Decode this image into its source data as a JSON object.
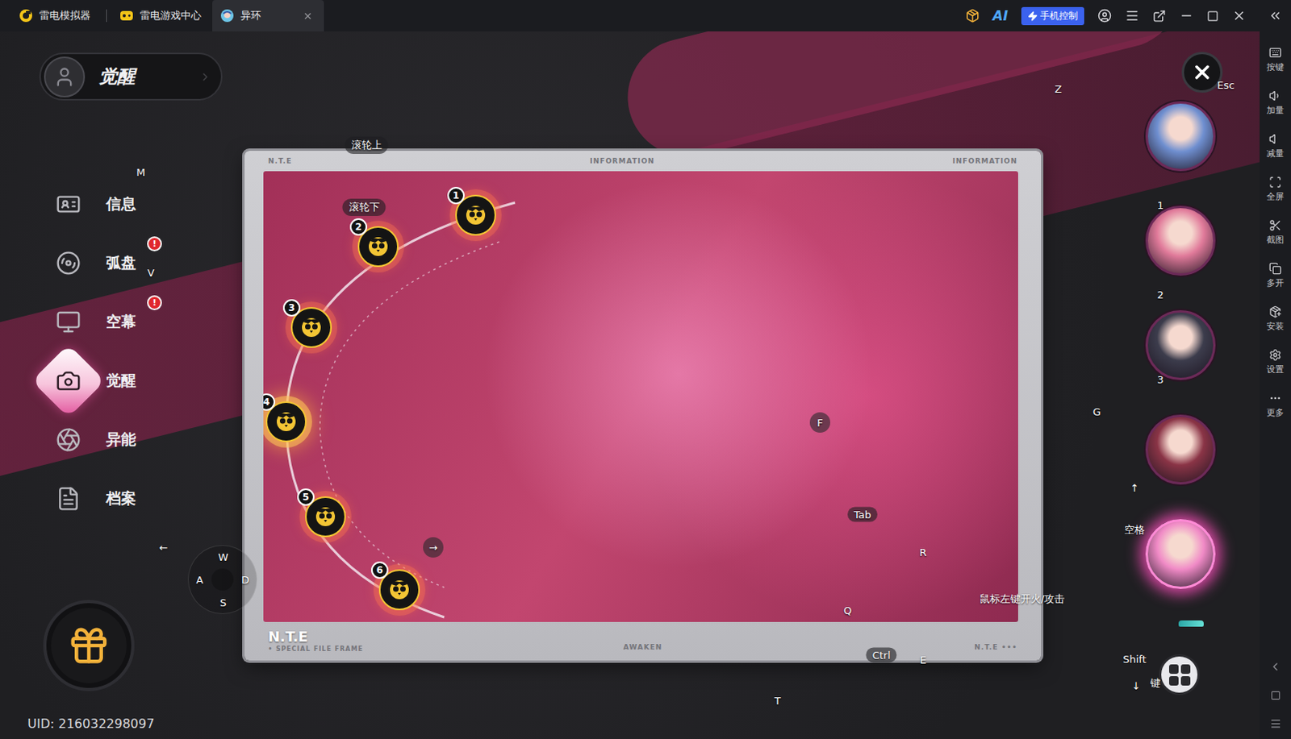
{
  "emulator": {
    "tabs": [
      {
        "label": "雷电模拟器",
        "selected": false
      },
      {
        "label": "雷电游戏中心",
        "selected": false
      },
      {
        "label": "异环",
        "selected": true
      }
    ],
    "ai_label": "AI",
    "phone_control": "手机控制",
    "sidebar": [
      "按键",
      "加量",
      "减量",
      "全屏",
      "截图",
      "多开",
      "安装",
      "设置",
      "更多"
    ]
  },
  "header": {
    "title": "觉醒"
  },
  "menu": [
    {
      "label": "信息",
      "badge": "",
      "selected": false
    },
    {
      "label": "弧盘",
      "badge": "!",
      "selected": false
    },
    {
      "label": "空幕",
      "badge": "!",
      "selected": false
    },
    {
      "label": "觉醒",
      "badge": "",
      "selected": true
    },
    {
      "label": "异能",
      "badge": "",
      "selected": false
    },
    {
      "label": "档案",
      "badge": "",
      "selected": false
    }
  ],
  "uid": "UID: 216032298097",
  "card": {
    "top_labels": [
      "N.T.E",
      "INFORMATION",
      "INFORMATION"
    ],
    "bottom": {
      "title": "N.T.E",
      "subtitle": "• SPECIAL FILE FRAME",
      "center": "AWAKEN",
      "right": "N.T.E •••"
    },
    "nodes": [
      {
        "number": "1",
        "selected": false
      },
      {
        "number": "2",
        "selected": false
      },
      {
        "number": "3",
        "selected": false
      },
      {
        "number": "4",
        "selected": true
      },
      {
        "number": "5",
        "selected": false
      },
      {
        "number": "6",
        "selected": false
      }
    ]
  },
  "portraits": [
    {
      "selected": false,
      "color": "#6f8fd0"
    },
    {
      "selected": false,
      "color": "#e07a9a"
    },
    {
      "selected": false,
      "color": "#3c3c4c"
    },
    {
      "selected": false,
      "color": "#8a3446"
    },
    {
      "selected": true,
      "color": "#f08ac6"
    }
  ],
  "keymap": [
    {
      "key": "滚轮上",
      "kind": "pill"
    },
    {
      "key": "滚轮下",
      "kind": "pill"
    },
    {
      "key": "M",
      "kind": "plain"
    },
    {
      "key": "V",
      "kind": "plain"
    },
    {
      "key": "Z",
      "kind": "plain"
    },
    {
      "key": "Esc",
      "kind": "plain"
    },
    {
      "key": "1",
      "kind": "plain"
    },
    {
      "key": "2",
      "kind": "plain"
    },
    {
      "key": "3",
      "kind": "plain"
    },
    {
      "key": "G",
      "kind": "plain"
    },
    {
      "key": "↑",
      "kind": "plain"
    },
    {
      "key": "空格",
      "kind": "plain"
    },
    {
      "key": "Shift",
      "kind": "plain"
    },
    {
      "key": "↓",
      "kind": "plain"
    },
    {
      "key": "键",
      "kind": "plain"
    },
    {
      "key": "F",
      "kind": "circle"
    },
    {
      "key": "Tab",
      "kind": "pill"
    },
    {
      "key": "R",
      "kind": "plain"
    },
    {
      "key": "Q",
      "kind": "plain"
    },
    {
      "key": "E",
      "kind": "plain"
    },
    {
      "key": "Ctrl",
      "kind": "pill"
    },
    {
      "key": "T",
      "kind": "plain"
    },
    {
      "key": "←",
      "kind": "plain"
    },
    {
      "key": "→",
      "kind": "circle"
    },
    {
      "key": "W",
      "kind": "plain"
    },
    {
      "key": "A",
      "kind": "plain"
    },
    {
      "key": "S",
      "kind": "plain"
    },
    {
      "key": "D",
      "kind": "plain"
    },
    {
      "key": "鼠标左键开火/攻击",
      "kind": "plain"
    }
  ]
}
